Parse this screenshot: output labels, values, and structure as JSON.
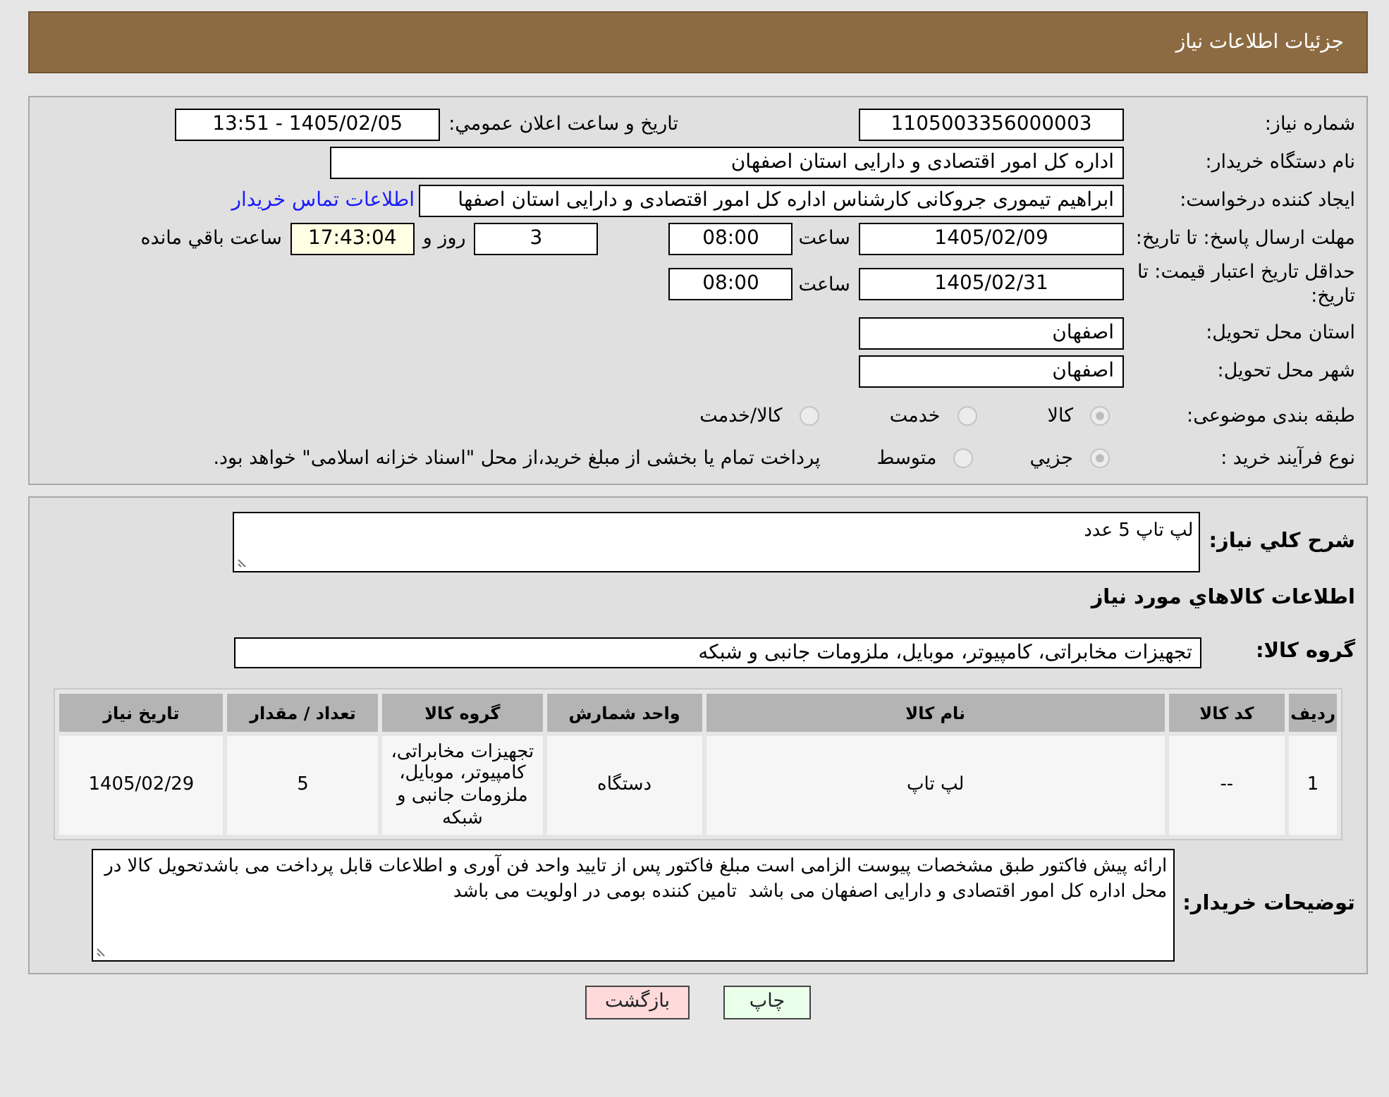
{
  "header": {
    "title": "جزئیات اطلاعات نیاز"
  },
  "need_number": {
    "label": "شماره نیاز:",
    "value": "1105003356000003"
  },
  "announce": {
    "label": "تاريخ و ساعت اعلان عمومي:",
    "value": "1405/02/05 - 13:51"
  },
  "buyer": {
    "label": "نام دستگاه خریدار:",
    "value": "اداره کل امور اقتصادی و دارایی استان اصفهان"
  },
  "creator": {
    "label": "ایجاد کننده درخواست:",
    "value": "ابراهیم تیموری جروکانی کارشناس اداره کل امور اقتصادی و دارایی استان اصفها",
    "link": "اطلاعات تماس خریدار"
  },
  "reply_deadline": {
    "label": "مهلت ارسال پاسخ: تا تاریخ:",
    "date": "1405/02/09",
    "time_label": "ساعت",
    "time": "08:00",
    "days": "3",
    "days_label": "روز و",
    "remaining": "17:43:04",
    "remaining_label": "ساعت باقي مانده"
  },
  "price_validity": {
    "label": "حداقل تاریخ اعتبار قیمت: تا تاریخ:",
    "date": "1405/02/31",
    "time_label": "ساعت",
    "time": "08:00"
  },
  "province": {
    "label": "استان محل تحویل:",
    "value": "اصفهان"
  },
  "city": {
    "label": "شهر محل تحویل:",
    "value": "اصفهان"
  },
  "category": {
    "label": "طبقه بندی موضوعی:",
    "options": [
      {
        "label": "كالا",
        "selected": true
      },
      {
        "label": "خدمت",
        "selected": false
      },
      {
        "label": "كالا/خدمت",
        "selected": false
      }
    ]
  },
  "process": {
    "label": "نوع فرآیند خرید :",
    "options": [
      {
        "label": "جزيي",
        "selected": true
      },
      {
        "label": "متوسط",
        "selected": false
      }
    ],
    "note": "پرداخت تمام یا بخشی از مبلغ خرید،از محل \"اسناد خزانه اسلامی\" خواهد بود."
  },
  "summary": {
    "label": "شرح کلي نياز:",
    "value": "لپ تاپ 5 عدد"
  },
  "goods_heading": "اطلاعات کالاهاي مورد نياز",
  "goods_group": {
    "label": "گروه کالا:",
    "value": "تجهیزات مخابراتی، کامپیوتر، موبایل، ملزومات جانبی و شبکه"
  },
  "table": {
    "columns": [
      "ردیف",
      "کد کالا",
      "نام کالا",
      "واحد شمارش",
      "گروه کالا",
      "تعداد / مقدار",
      "تاریخ نیاز"
    ],
    "rows": [
      [
        "1",
        "--",
        "لپ تاپ",
        "دستگاه",
        "تجهیزات مخابراتی، کامپیوتر، موبایل، ملزومات جانبی و شبکه",
        "5",
        "1405/02/29"
      ]
    ]
  },
  "buyer_notes": {
    "label": "توضیحات خریدار:",
    "value": "ارائه پیش فاکتور طبق مشخصات پیوست الزامی است مبلغ فاکتور پس از تایید واحد فن آوری و اطلاعات قابل پرداخت می باشدتحویل کالا در محل اداره کل امور اقتصادی و دارایی اصفهان می باشد  تامین کننده بومی در اولویت می باشد"
  },
  "buttons": [
    {
      "label": "چاپ",
      "kind": "print"
    },
    {
      "label": "بازگشت",
      "kind": "back"
    }
  ]
}
